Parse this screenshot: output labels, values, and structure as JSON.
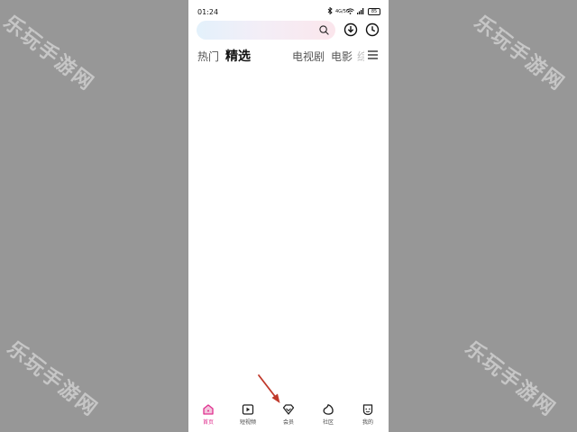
{
  "watermark": "乐玩手游网",
  "status_bar": {
    "time": "01:24",
    "icons": [
      "bluetooth-icon",
      "signal-text-icon",
      "wifi-icon",
      "cell-signal-icon",
      "battery-icon"
    ],
    "network_text": "4G/5G",
    "battery_text": "85"
  },
  "search": {
    "placeholder": ""
  },
  "header": {
    "download_icon": "download-icon",
    "history_icon": "history-clock-icon"
  },
  "tabs": [
    {
      "label": "热门",
      "active": false
    },
    {
      "label": "精选",
      "active": true
    },
    {
      "label": "电视剧",
      "active": false
    },
    {
      "label": "电影",
      "active": false
    },
    {
      "label": "综",
      "active": false
    }
  ],
  "bottom_nav": [
    {
      "label": "首页",
      "icon": "home-icon",
      "active": true
    },
    {
      "label": "短视频",
      "icon": "play-icon",
      "active": false
    },
    {
      "label": "会员",
      "icon": "diamond-icon",
      "active": false
    },
    {
      "label": "社区",
      "icon": "community-icon",
      "active": false
    },
    {
      "label": "我的",
      "icon": "profile-icon",
      "active": false
    }
  ],
  "colors": {
    "accent": "#e0308f",
    "annotation_arrow": "#c0392b",
    "background": "#979797"
  }
}
